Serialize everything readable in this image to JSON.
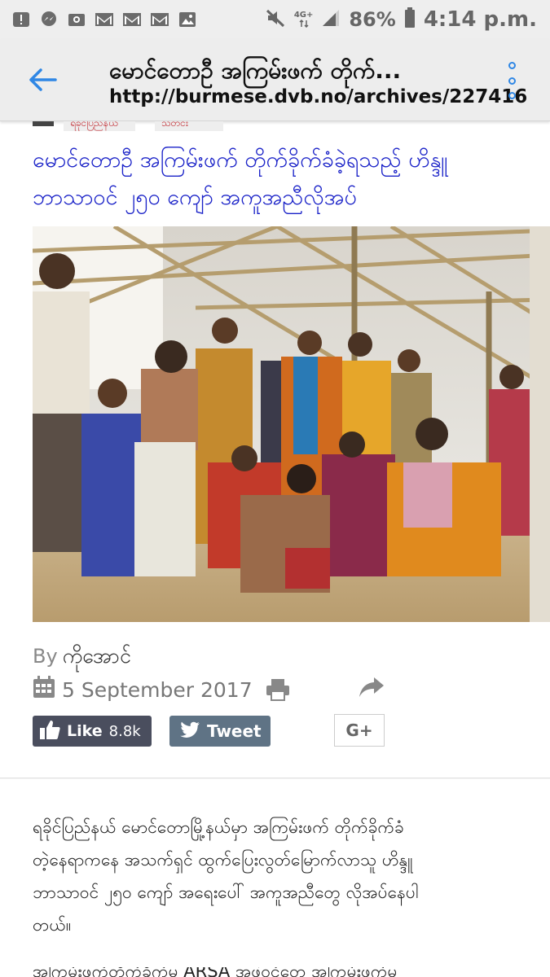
{
  "status_bar": {
    "network": "4G+",
    "battery_percent": "86%",
    "time": "4:14 p.m.",
    "icons": [
      "alert-icon",
      "messenger-icon",
      "camera-icon",
      "gmail-icon",
      "gmail-icon",
      "gmail-icon",
      "image-icon"
    ]
  },
  "browser": {
    "page_title": "မောင်တောဦ အကြမ်းဖက် တိုက်...",
    "url": "http://burmese.dvb.no/archives/227416",
    "accent_color": "#2f87e5"
  },
  "article": {
    "categories": [
      "ရခိုင်ပြည်နယ်",
      "သတင်း"
    ],
    "headline_line1": "မောင်တောဦ အကြမ်းဖက် တိုက်ခိုက်ခံခဲ့ရသည့် ဟိန္ဒူ",
    "headline_line2": "ဘာသာဝင် ၂၅၀ ကျော် အကူအညီလိုအပ်",
    "byline_prefix": "By",
    "author": "ကိုအောင်",
    "date": "5 September 2017",
    "body_lines": [
      "ရခိုင်ပြည်နယ် မောင်တောမြို့နယ်မှာ အကြမ်းဖက် တိုက်ခိုက်ခံ",
      "တဲ့နေရာကနေ အသက်ရှင် ထွက်ပြေးလွတ်မြောက်လာသူ ဟိန္ဒူ",
      "ဘာသာဝင် ၂၅၀ ကျော် အရေးပေါ် အကူအညီတွေ လိုအပ်နေပါ",
      "တယ်။"
    ],
    "next_para_peek": "အကြမ်းဖက်တိုက်ခိုက်မှု ARSA အဖွဲ့ဝင်တွေ အကြမ်းဖက်မှု"
  },
  "social": {
    "like_label": "Like",
    "like_count": "8.8k",
    "tweet_label": "Tweet",
    "gplus_label": "G+"
  }
}
